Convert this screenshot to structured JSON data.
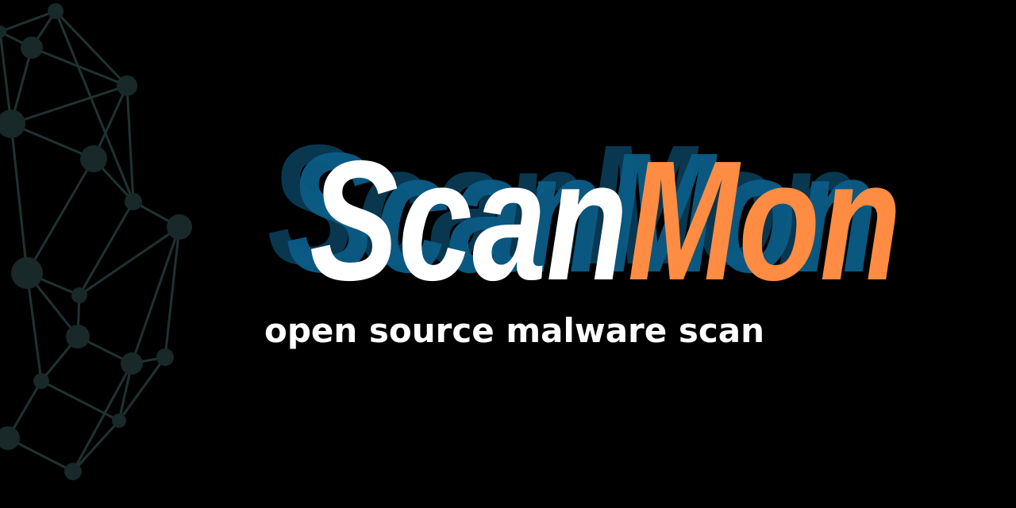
{
  "brand": {
    "part_one": "Scan",
    "part_two": "Mon",
    "tagline": "open source malware scan"
  },
  "colors": {
    "background": "#000000",
    "primary_text": "#ffffff",
    "accent": "#ff8c42",
    "shadow_light": "#0b5c86",
    "shadow_dark": "#0a3a55",
    "network_line": "#1f3232",
    "network_node": "#192828"
  },
  "icons": {
    "decoration": "network-mesh-icon"
  }
}
